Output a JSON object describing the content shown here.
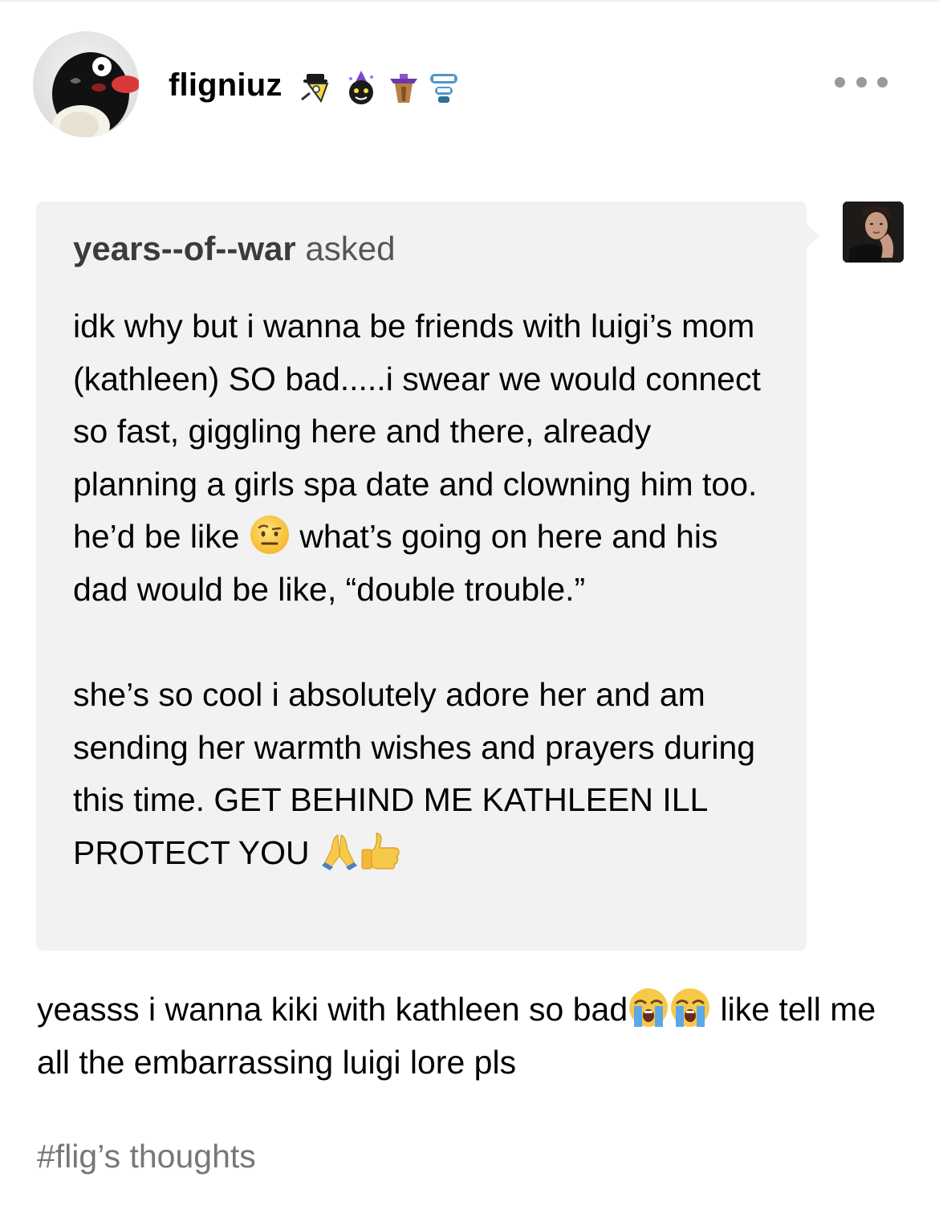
{
  "post": {
    "author": "fligniuz",
    "badges": [
      "detective-badge-icon",
      "wizard-cat-badge-icon",
      "gift-badge-icon",
      "chatter-teeth-badge-icon"
    ],
    "more_menu": "more-options"
  },
  "ask": {
    "asker": "years--of--war",
    "asked_label": "asked",
    "p1_a": "idk why but i wanna be friends with luigi’s mom (kathleen) SO bad.....i swear we would connect so fast, giggling here and there, already planning a girls spa date and clowning him too. he’d be like ",
    "p1_b": " what’s going on here and his dad would be like, “double trouble.”",
    "p2": "she’s so cool i absolutely adore her and am sending her warmth wishes and prayers during this time. GET BEHIND ME KATHLEEN ILL PROTECT YOU "
  },
  "answer": {
    "part1": "yeasss i wanna kiki with kathleen so bad",
    "part2": " like tell me all the embarrassing luigi lore pls"
  },
  "tags": [
    "#flig’s thoughts"
  ],
  "colors": {
    "ask_background": "#f2f2f2",
    "tag_text": "#777777",
    "asked_text": "#555555"
  }
}
